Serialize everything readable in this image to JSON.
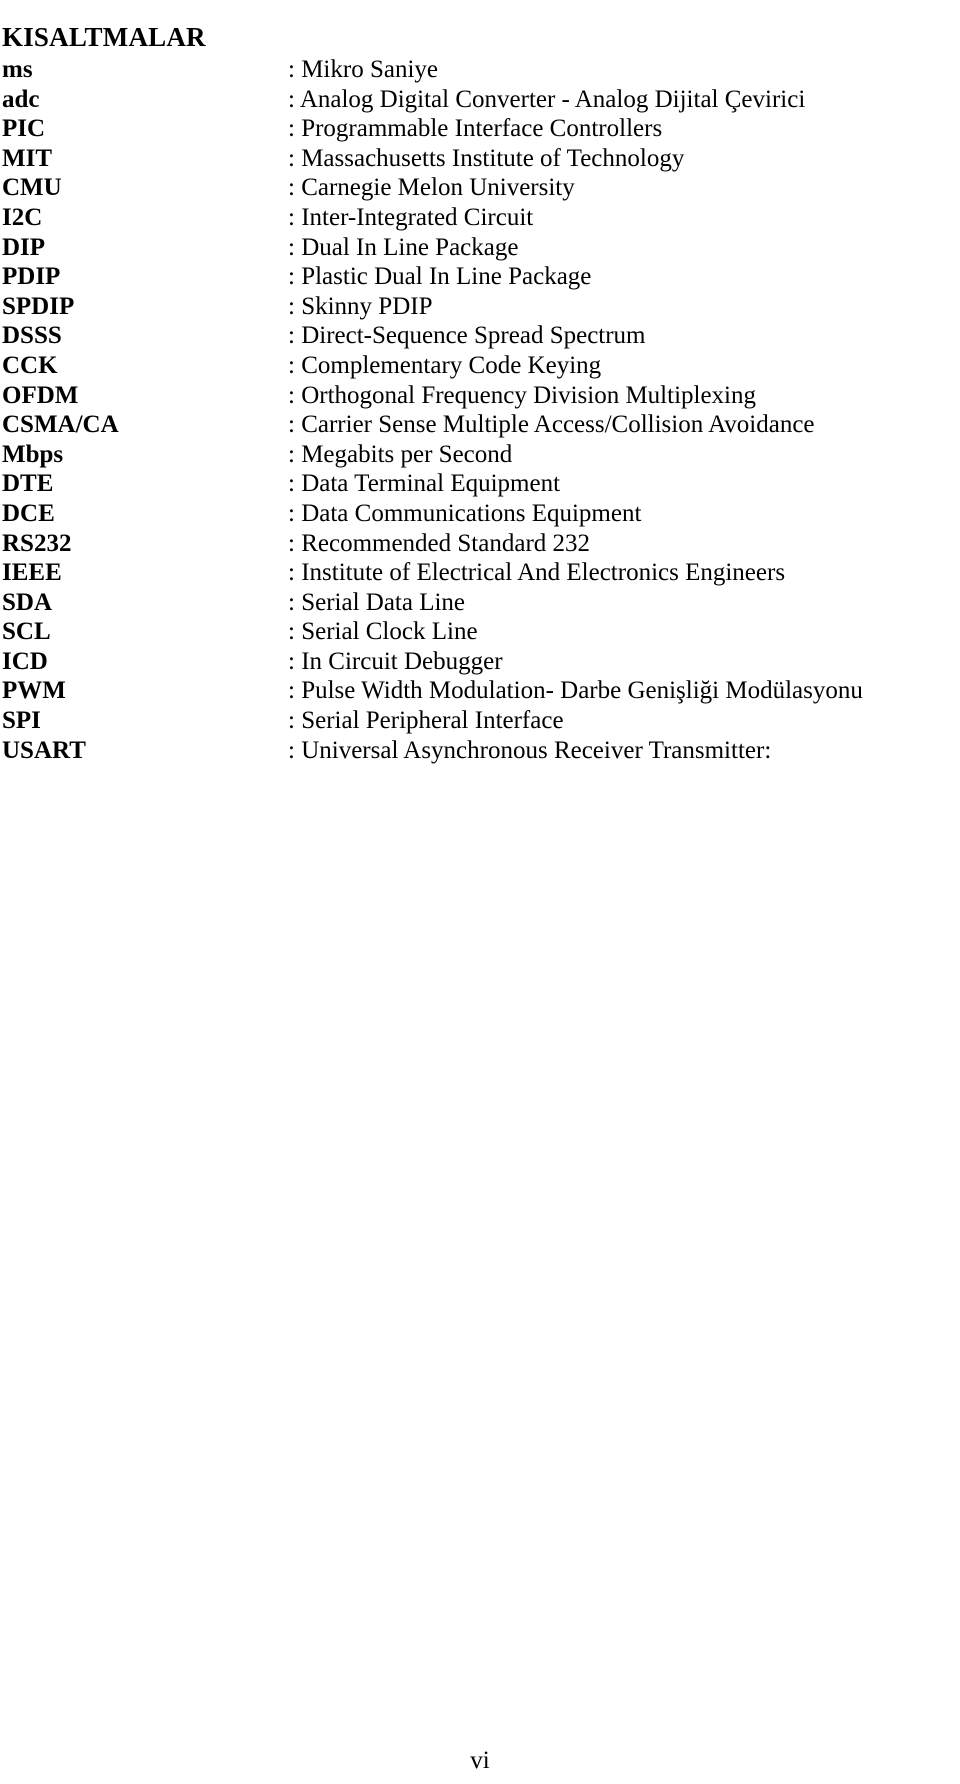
{
  "document": {
    "title": "KISALTMALAR",
    "page_number": "vi",
    "separator": ":"
  },
  "abbreviations": [
    {
      "term": "ms",
      "definition": ": Mikro Saniye"
    },
    {
      "term": "adc",
      "definition": ": Analog Digital Converter - Analog Dijital Çevirici"
    },
    {
      "term": "PIC",
      "definition": ": Programmable Interface Controllers"
    },
    {
      "term": "MIT",
      "definition": ": Massachusetts Institute of Technology"
    },
    {
      "term": "CMU",
      "definition": ": Carnegie Melon University"
    },
    {
      "term": "I2C",
      "definition": ": Inter-Integrated Circuit"
    },
    {
      "term": "DIP",
      "definition": ": Dual In Line Package"
    },
    {
      "term": "PDIP",
      "definition": ": Plastic Dual In Line Package"
    },
    {
      "term": "SPDIP",
      "definition": ": Skinny PDIP"
    },
    {
      "term": "DSSS",
      "definition": ": Direct-Sequence Spread Spectrum"
    },
    {
      "term": "CCK",
      "definition": ": Complementary Code Keying"
    },
    {
      "term": "OFDM",
      "definition": ": Orthogonal Frequency Division Multiplexing"
    },
    {
      "term": "CSMA/CA",
      "definition": ": Carrier Sense Multiple Access/Collision Avoidance"
    },
    {
      "term": "Mbps",
      "definition": ": Megabits per Second"
    },
    {
      "term": "DTE",
      "definition": ": Data Terminal Equipment"
    },
    {
      "term": "DCE",
      "definition": ": Data Communications Equipment"
    },
    {
      "term": "RS232",
      "definition": ": Recommended Standard 232"
    },
    {
      "term": "IEEE",
      "definition": ": Institute of Electrical And Electronics Engineers"
    },
    {
      "term": "SDA",
      "definition": ": Serial Data Line"
    },
    {
      "term": "SCL",
      "definition": ": Serial Clock Line"
    },
    {
      "term": "ICD",
      "definition": ": In Circuit Debugger"
    },
    {
      "term": "PWM",
      "definition": ": Pulse Width Modulation- Darbe Genişliği Modülasyonu"
    },
    {
      "term": "SPI",
      "definition": ": Serial Peripheral Interface"
    },
    {
      "term": "USART",
      "definition": ": Universal Asynchronous Receiver Transmitter:"
    }
  ]
}
